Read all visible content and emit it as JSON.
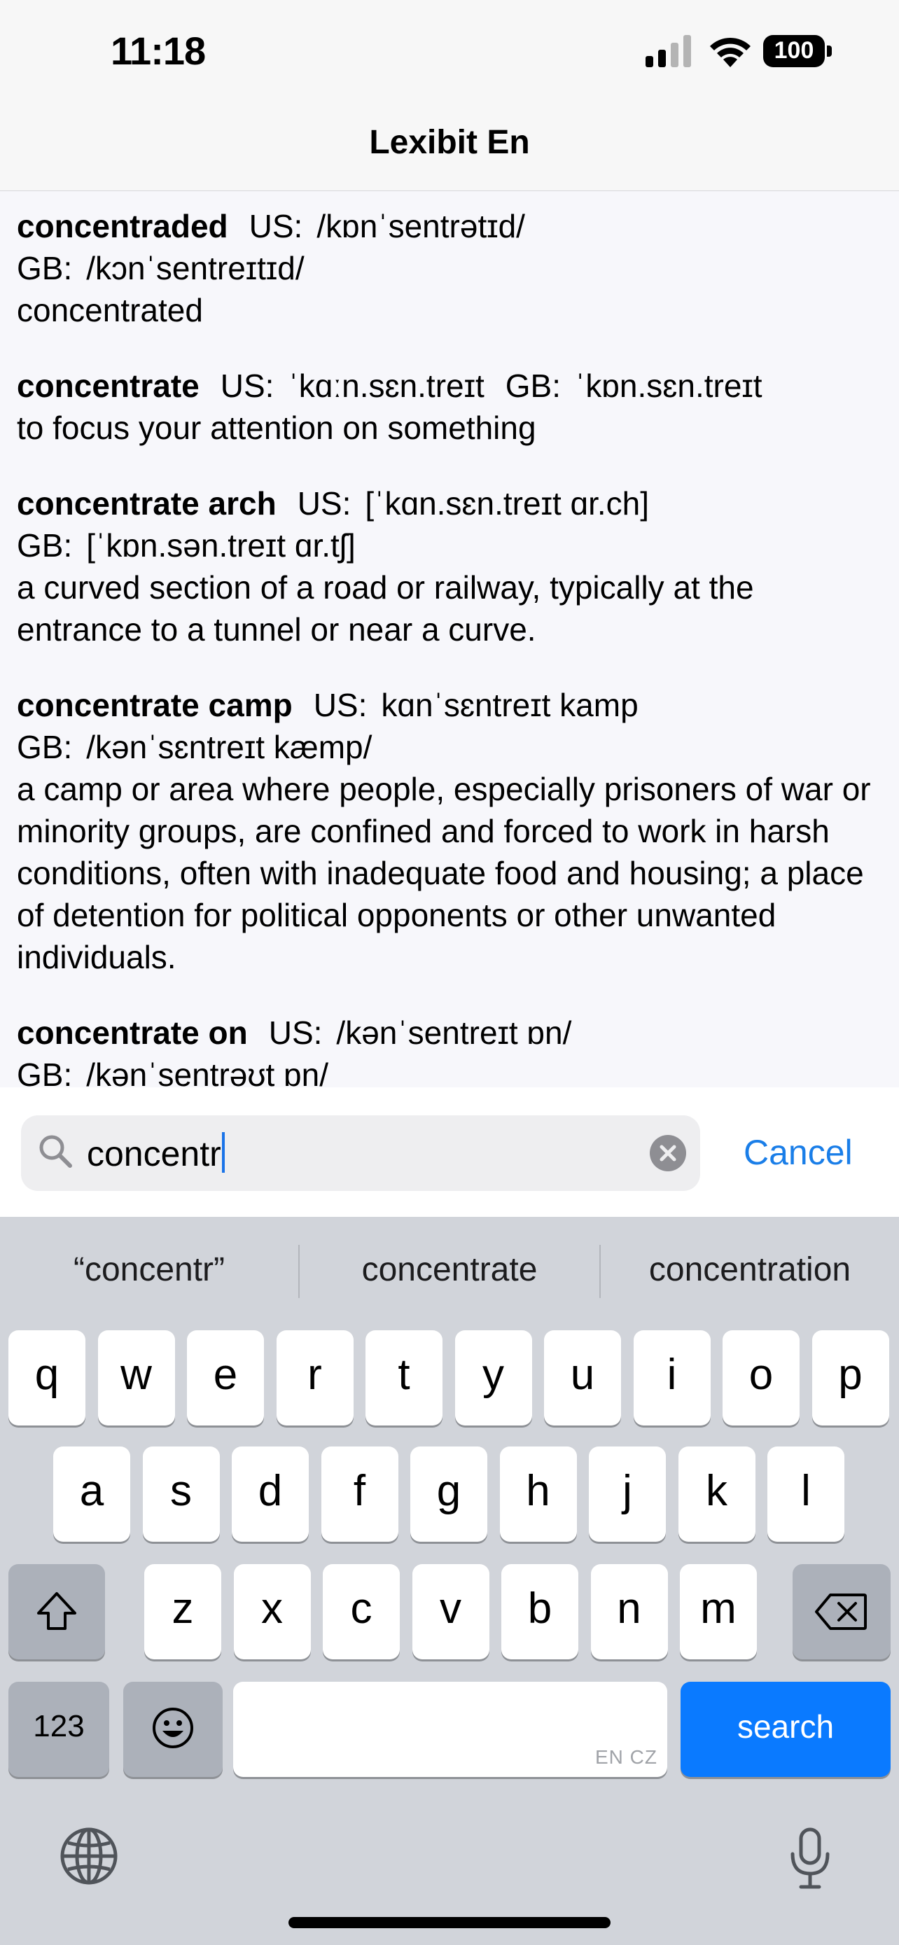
{
  "status_bar": {
    "time": "11:18",
    "battery": "100"
  },
  "nav": {
    "title": "Lexibit En"
  },
  "entries": [
    {
      "word": "concentraded",
      "lines": [
        [
          {
            "t": "US:",
            "k": "label"
          },
          {
            "t": "/kɒnˈsentrətɪd/",
            "k": "value"
          }
        ],
        [
          {
            "t": "GB:",
            "k": "label"
          },
          {
            "t": "/kɔnˈsentreɪtɪd/",
            "k": "value"
          }
        ]
      ],
      "definition": "concentrated"
    },
    {
      "word": "concentrate",
      "lines": [
        [
          {
            "t": "US:",
            "k": "label"
          },
          {
            "t": "ˈkɑːn.sɛn.treɪt",
            "k": "value"
          },
          {
            "t": "GB:",
            "k": "label"
          },
          {
            "t": "ˈkɒn.sɛn.treɪt",
            "k": "value"
          }
        ]
      ],
      "definition": "to focus your attention on something"
    },
    {
      "word": "concentrate arch",
      "lines": [
        [
          {
            "t": "US:",
            "k": "label"
          },
          {
            "t": "[ˈkɑn.sɛn.treɪt ɑr.ch]",
            "k": "value"
          }
        ],
        [
          {
            "t": "GB:",
            "k": "label"
          },
          {
            "t": "[ˈkɒn.sən.treɪt ɑr.tʃ]",
            "k": "value"
          }
        ]
      ],
      "definition": "a curved section of a road or railway, typically at the entrance to a tunnel or near a curve."
    },
    {
      "word": "concentrate camp",
      "lines": [
        [
          {
            "t": "US:",
            "k": "label"
          },
          {
            "t": "kɑnˈsɛntreɪt kamp",
            "k": "value"
          }
        ],
        [
          {
            "t": "GB:",
            "k": "label"
          },
          {
            "t": "/kənˈsɛntreɪt kæmp/",
            "k": "value"
          }
        ]
      ],
      "definition": "a camp or area where people, especially prisoners of war or minority groups, are confined and forced to work in harsh conditions, often with inadequate food and housing; a place of detention for political opponents or other unwanted individuals."
    },
    {
      "word": "concentrate on",
      "lines": [
        [
          {
            "t": "US:",
            "k": "label"
          },
          {
            "t": "/kənˈsentreɪt ɒn/",
            "k": "value"
          }
        ],
        [
          {
            "t": "GB:",
            "k": "label"
          },
          {
            "t": "/kənˈsentrəʊt ɒn/",
            "k": "value"
          }
        ]
      ],
      "definition": ""
    }
  ],
  "search": {
    "query": "concentr",
    "cancel_label": "Cancel"
  },
  "keyboard": {
    "suggestions": [
      "“concentr”",
      "concentrate",
      "concentration"
    ],
    "row1": [
      "q",
      "w",
      "e",
      "r",
      "t",
      "y",
      "u",
      "i",
      "o",
      "p"
    ],
    "row2": [
      "a",
      "s",
      "d",
      "f",
      "g",
      "h",
      "j",
      "k",
      "l"
    ],
    "row3": [
      "z",
      "x",
      "c",
      "v",
      "b",
      "n",
      "m"
    ],
    "numbers_label": "123",
    "space_hint": "EN CZ",
    "search_label": "search"
  },
  "colors": {
    "accent": "#1a7ee8",
    "search_key": "#0a7aff",
    "keyboard_bg": "#d1d4da"
  }
}
